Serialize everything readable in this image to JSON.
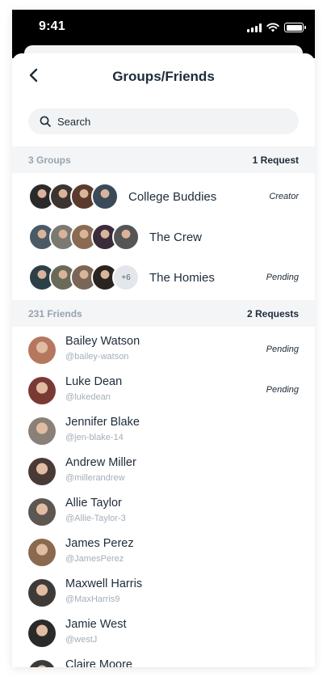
{
  "status_bar": {
    "time": "9:41",
    "icons": [
      "cellular-signal-icon",
      "wifi-icon",
      "battery-icon"
    ]
  },
  "header": {
    "title": "Groups/Friends",
    "back_icon": "chevron-left-icon"
  },
  "search": {
    "placeholder": "Search",
    "icon": "search-icon"
  },
  "groups_section": {
    "count_label": "3 Groups",
    "requests_label": "1 Request",
    "items": [
      {
        "name": "College Buddies",
        "tag": "Creator",
        "avatar_colors": [
          "#2a2a2a",
          "#3b3430",
          "#5a3a2c",
          "#3a4a58"
        ],
        "extra": ""
      },
      {
        "name": "The Crew",
        "tag": "",
        "avatar_colors": [
          "#4a5a66",
          "#7a7a72",
          "#8a6a52",
          "#3a2c3a",
          "#555555"
        ],
        "extra": ""
      },
      {
        "name": "The Homies",
        "tag": "Pending",
        "avatar_colors": [
          "#2d4048",
          "#6a6a5a",
          "#7a6656",
          "#2a2420"
        ],
        "extra": "+6"
      }
    ]
  },
  "friends_section": {
    "count_label": "231 Friends",
    "requests_label": "2 Requests",
    "items": [
      {
        "name": "Bailey Watson",
        "handle": "@bailey-watson",
        "tag": "Pending",
        "avatar_color": "#b5785e"
      },
      {
        "name": "Luke Dean",
        "handle": "@lukedean",
        "tag": "Pending",
        "avatar_color": "#7a3a34"
      },
      {
        "name": "Jennifer Blake",
        "handle": "@jen-blake-14",
        "tag": "",
        "avatar_color": "#8a8078"
      },
      {
        "name": "Andrew Miller",
        "handle": "@millerandrew",
        "tag": "",
        "avatar_color": "#4a3a36"
      },
      {
        "name": "Allie Taylor",
        "handle": "@Allie-Taylor-3",
        "tag": "",
        "avatar_color": "#5e5650"
      },
      {
        "name": "James Perez",
        "handle": "@JamesPerez",
        "tag": "",
        "avatar_color": "#8a6a4e"
      },
      {
        "name": "Maxwell Harris",
        "handle": "@MaxHarris9",
        "tag": "",
        "avatar_color": "#3e3a38"
      },
      {
        "name": "Jamie West",
        "handle": "@westJ",
        "tag": "",
        "avatar_color": "#2a2a2a"
      },
      {
        "name": "Claire Moore",
        "handle": "",
        "tag": "",
        "avatar_color": "#3a3a3a"
      }
    ]
  }
}
